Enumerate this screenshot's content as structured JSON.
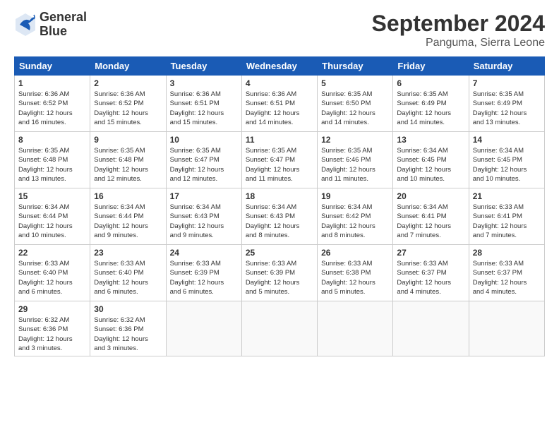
{
  "logo": {
    "line1": "General",
    "line2": "Blue"
  },
  "title": "September 2024",
  "location": "Panguma, Sierra Leone",
  "days_of_week": [
    "Sunday",
    "Monday",
    "Tuesday",
    "Wednesday",
    "Thursday",
    "Friday",
    "Saturday"
  ],
  "weeks": [
    [
      {
        "day": "1",
        "info": "Sunrise: 6:36 AM\nSunset: 6:52 PM\nDaylight: 12 hours\nand 16 minutes."
      },
      {
        "day": "2",
        "info": "Sunrise: 6:36 AM\nSunset: 6:52 PM\nDaylight: 12 hours\nand 15 minutes."
      },
      {
        "day": "3",
        "info": "Sunrise: 6:36 AM\nSunset: 6:51 PM\nDaylight: 12 hours\nand 15 minutes."
      },
      {
        "day": "4",
        "info": "Sunrise: 6:36 AM\nSunset: 6:51 PM\nDaylight: 12 hours\nand 14 minutes."
      },
      {
        "day": "5",
        "info": "Sunrise: 6:35 AM\nSunset: 6:50 PM\nDaylight: 12 hours\nand 14 minutes."
      },
      {
        "day": "6",
        "info": "Sunrise: 6:35 AM\nSunset: 6:49 PM\nDaylight: 12 hours\nand 14 minutes."
      },
      {
        "day": "7",
        "info": "Sunrise: 6:35 AM\nSunset: 6:49 PM\nDaylight: 12 hours\nand 13 minutes."
      }
    ],
    [
      {
        "day": "8",
        "info": "Sunrise: 6:35 AM\nSunset: 6:48 PM\nDaylight: 12 hours\nand 13 minutes."
      },
      {
        "day": "9",
        "info": "Sunrise: 6:35 AM\nSunset: 6:48 PM\nDaylight: 12 hours\nand 12 minutes."
      },
      {
        "day": "10",
        "info": "Sunrise: 6:35 AM\nSunset: 6:47 PM\nDaylight: 12 hours\nand 12 minutes."
      },
      {
        "day": "11",
        "info": "Sunrise: 6:35 AM\nSunset: 6:47 PM\nDaylight: 12 hours\nand 11 minutes."
      },
      {
        "day": "12",
        "info": "Sunrise: 6:35 AM\nSunset: 6:46 PM\nDaylight: 12 hours\nand 11 minutes."
      },
      {
        "day": "13",
        "info": "Sunrise: 6:34 AM\nSunset: 6:45 PM\nDaylight: 12 hours\nand 10 minutes."
      },
      {
        "day": "14",
        "info": "Sunrise: 6:34 AM\nSunset: 6:45 PM\nDaylight: 12 hours\nand 10 minutes."
      }
    ],
    [
      {
        "day": "15",
        "info": "Sunrise: 6:34 AM\nSunset: 6:44 PM\nDaylight: 12 hours\nand 10 minutes."
      },
      {
        "day": "16",
        "info": "Sunrise: 6:34 AM\nSunset: 6:44 PM\nDaylight: 12 hours\nand 9 minutes."
      },
      {
        "day": "17",
        "info": "Sunrise: 6:34 AM\nSunset: 6:43 PM\nDaylight: 12 hours\nand 9 minutes."
      },
      {
        "day": "18",
        "info": "Sunrise: 6:34 AM\nSunset: 6:43 PM\nDaylight: 12 hours\nand 8 minutes."
      },
      {
        "day": "19",
        "info": "Sunrise: 6:34 AM\nSunset: 6:42 PM\nDaylight: 12 hours\nand 8 minutes."
      },
      {
        "day": "20",
        "info": "Sunrise: 6:34 AM\nSunset: 6:41 PM\nDaylight: 12 hours\nand 7 minutes."
      },
      {
        "day": "21",
        "info": "Sunrise: 6:33 AM\nSunset: 6:41 PM\nDaylight: 12 hours\nand 7 minutes."
      }
    ],
    [
      {
        "day": "22",
        "info": "Sunrise: 6:33 AM\nSunset: 6:40 PM\nDaylight: 12 hours\nand 6 minutes."
      },
      {
        "day": "23",
        "info": "Sunrise: 6:33 AM\nSunset: 6:40 PM\nDaylight: 12 hours\nand 6 minutes."
      },
      {
        "day": "24",
        "info": "Sunrise: 6:33 AM\nSunset: 6:39 PM\nDaylight: 12 hours\nand 6 minutes."
      },
      {
        "day": "25",
        "info": "Sunrise: 6:33 AM\nSunset: 6:39 PM\nDaylight: 12 hours\nand 5 minutes."
      },
      {
        "day": "26",
        "info": "Sunrise: 6:33 AM\nSunset: 6:38 PM\nDaylight: 12 hours\nand 5 minutes."
      },
      {
        "day": "27",
        "info": "Sunrise: 6:33 AM\nSunset: 6:37 PM\nDaylight: 12 hours\nand 4 minutes."
      },
      {
        "day": "28",
        "info": "Sunrise: 6:33 AM\nSunset: 6:37 PM\nDaylight: 12 hours\nand 4 minutes."
      }
    ],
    [
      {
        "day": "29",
        "info": "Sunrise: 6:32 AM\nSunset: 6:36 PM\nDaylight: 12 hours\nand 3 minutes."
      },
      {
        "day": "30",
        "info": "Sunrise: 6:32 AM\nSunset: 6:36 PM\nDaylight: 12 hours\nand 3 minutes."
      },
      {
        "day": "",
        "info": ""
      },
      {
        "day": "",
        "info": ""
      },
      {
        "day": "",
        "info": ""
      },
      {
        "day": "",
        "info": ""
      },
      {
        "day": "",
        "info": ""
      }
    ]
  ]
}
